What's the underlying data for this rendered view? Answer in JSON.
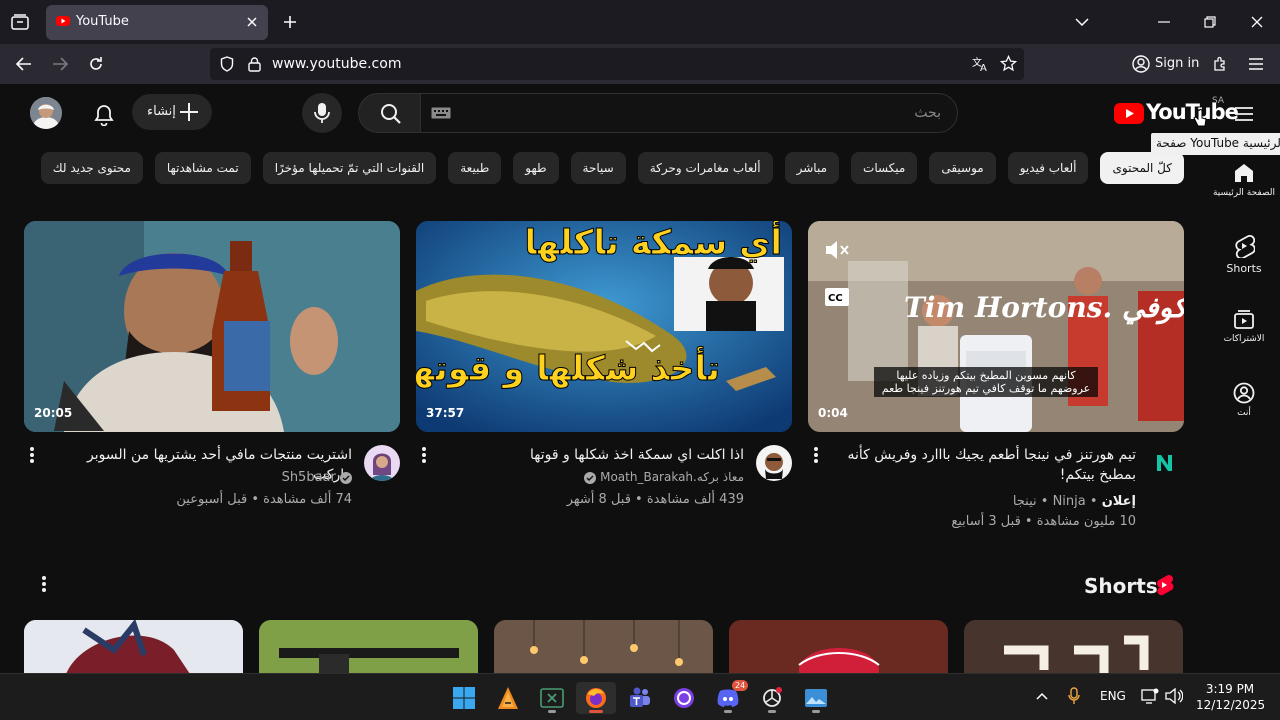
{
  "browser": {
    "tab_title": "YouTube",
    "url_domain": "www.youtube.com",
    "signin_label": "Sign in"
  },
  "yt": {
    "create_label": "إنشاء",
    "search_placeholder": "بحث",
    "logo_text": "YouTube",
    "country_code": "SA",
    "tooltip": "صفحة YouTube الرئيسية",
    "brand_color": "#ff0000"
  },
  "chips": [
    "كلّ المحتوى",
    "ألعاب فيديو",
    "موسيقى",
    "ميكسات",
    "مباشر",
    "ألعاب مغامرات وحركة",
    "سياحة",
    "طهو",
    "طبيعة",
    "القنوات التي تمّ تحميلها مؤخرًا",
    "تمت مشاهدتها",
    "محتوى جديد لك"
  ],
  "rail": [
    {
      "icon": "home-icon",
      "label": "الصفحة الرئيسية"
    },
    {
      "icon": "shorts-icon",
      "label": "Shorts"
    },
    {
      "icon": "subscriptions-icon",
      "label": "الاشتراكات"
    },
    {
      "icon": "you-icon",
      "label": "أنت"
    }
  ],
  "videos": [
    {
      "thumb_text": "Tim Hortons. كوفي",
      "caption_line1": "كانهم مسوين المطبخ بيتكم وزياده عليها",
      "caption_line2": "عروضهم ما توقف كافي تيم هورتنز فينجا طعم",
      "duration": "0:04",
      "title": "تيم هورتنز في نينجا أطعم يجيك بااارد وفريش كأنه بمطبخ بيتكم!",
      "ad_label": "إعلان",
      "channel": "Ninja • نينجا",
      "meta": "10 مليون مشاهدة • قبل 3 أسابيع"
    },
    {
      "thumb_title_top": "أي سمكة تاكلها",
      "thumb_title_bottom": "تأخذ شكلها و قوتها",
      "duration": "37:57",
      "title": "اذا اكلت اي سمكة اخذ شكلها و قوتها",
      "channel": "معاذ بركه.Moath_Barakah",
      "meta": "439 ألف مشاهدة • قبل 8 أشهر"
    },
    {
      "duration": "20:05",
      "title": "اشتريت منتجات مافي أحد يشتريها من السوبر ماركت",
      "channel": "Sh5baar",
      "meta": "74 ألف مشاهدة • قبل أسبوعين"
    }
  ],
  "shorts_title": "Shorts",
  "taskbar": {
    "lang": "ENG",
    "time": "3:19 PM",
    "date": "12/12/2025",
    "discord_badge": "24"
  }
}
